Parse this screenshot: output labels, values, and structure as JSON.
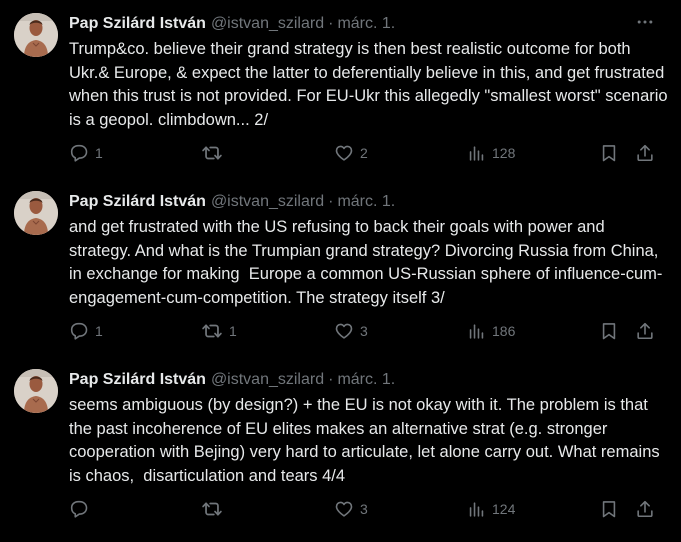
{
  "tweets": [
    {
      "author_name": "Pap Szilárd István",
      "author_handle": "@istvan_szilard",
      "separator": "·",
      "date": "márc. 1.",
      "text": "Trump&co. believe their grand strategy is then best realistic outcome for both Ukr.& Europe, & expect the latter to deferentially believe in this, and get frustrated when this trust is not provided. For EU-Ukr this allegedly \"smallest worst\" scenario is a geopol. climbdown... 2/",
      "replies": "1",
      "retweets": "",
      "likes": "2",
      "views": "128"
    },
    {
      "author_name": "Pap Szilárd István",
      "author_handle": "@istvan_szilard",
      "separator": "·",
      "date": "márc. 1.",
      "text": "and get frustrated with the US refusing to back their goals with power and strategy. And what is the Trumpian grand strategy? Divorcing Russia from China, in exchange for making  Europe a common US-Russian sphere of influence-cum-engagement-cum-competition. The strategy itself 3/",
      "replies": "1",
      "retweets": "1",
      "likes": "3",
      "views": "186"
    },
    {
      "author_name": "Pap Szilárd István",
      "author_handle": "@istvan_szilard",
      "separator": "·",
      "date": "márc. 1.",
      "text": "seems ambiguous (by design?) + the EU is not okay with it. The problem is that the past incoherence of EU elites makes an alternative strat (e.g. stronger cooperation with Bejing) very hard to articulate, let alone carry out. What remains is chaos,  disarticulation and tears 4/4",
      "replies": "",
      "retweets": "",
      "likes": "3",
      "views": "124"
    }
  ],
  "icons": {
    "more": "more-horizontal-icon",
    "reply": "reply-bubble-icon",
    "retweet": "retweet-icon",
    "like": "heart-icon",
    "views": "views-bar-chart-icon",
    "bookmark": "bookmark-icon",
    "share": "share-upload-icon"
  },
  "colors": {
    "background": "#000000",
    "text_primary": "#e7e9ea",
    "text_secondary": "#71767b"
  }
}
